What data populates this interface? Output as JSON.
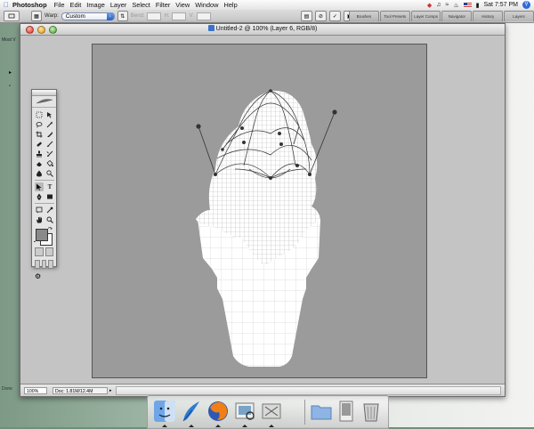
{
  "menubar": {
    "app_name": "Photoshop",
    "menus": [
      "File",
      "Edit",
      "Image",
      "Layer",
      "Select",
      "Filter",
      "View",
      "Window",
      "Help"
    ],
    "clock": "Sat 7:57 PM"
  },
  "options_bar": {
    "warp_label": "Warp:",
    "warp_value": "Custom",
    "bend_label": "Bend:",
    "h_label": "H:",
    "v_label": "V:",
    "palette_tabs": [
      "Brushes",
      "Tool Presets",
      "Layer Comps",
      "Navigator",
      "History",
      "Layers"
    ]
  },
  "desktop": {
    "partial_label": "Most V"
  },
  "document": {
    "title": "Untitled-2 @ 100% (Layer 6, RGB/8)",
    "zoom": "100%",
    "doc_info": "Doc: 1.81M/12.4M",
    "left_status": "Done"
  },
  "colors": {
    "canvas_bg": "#9b9b9b",
    "window_bg": "#c4c4c4",
    "shape_fill": "#ffffff",
    "mesh_line": "#b0b0b0"
  },
  "dock": {
    "items": [
      "finder-icon",
      "mail-icon",
      "firefox-icon",
      "preview-icon",
      "app-icon",
      "folder-icon",
      "document-icon",
      "trash-icon"
    ]
  }
}
